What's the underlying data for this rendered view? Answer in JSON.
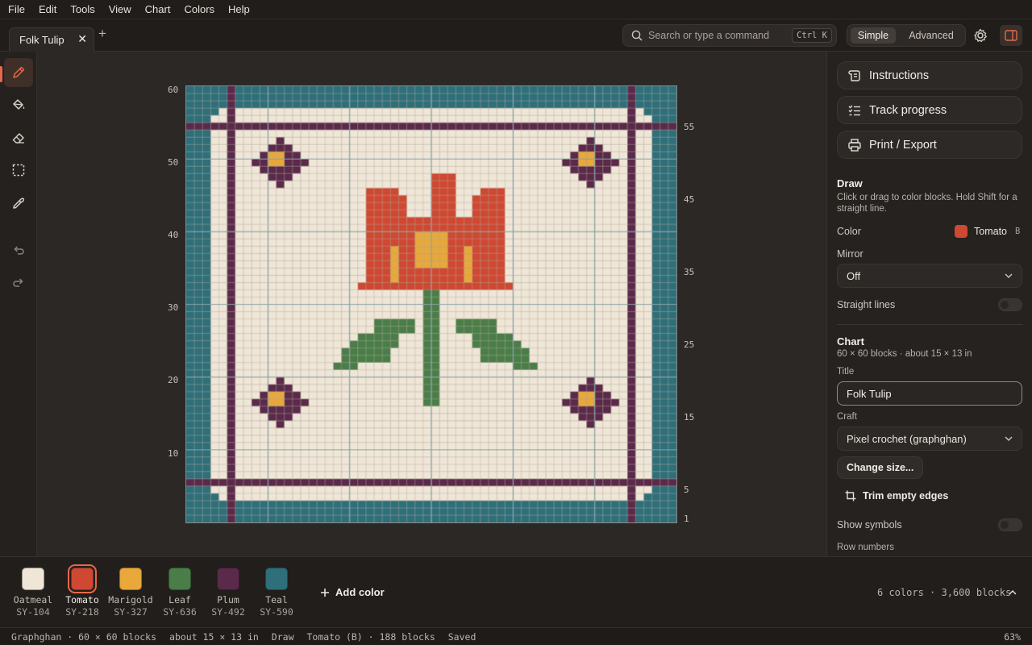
{
  "menu": [
    "File",
    "Edit",
    "Tools",
    "View",
    "Chart",
    "Colors",
    "Help"
  ],
  "tab": {
    "title": "Folk Tulip",
    "close": "✕",
    "add": "+"
  },
  "search": {
    "placeholder": "Search or type a command",
    "shortcut": "Ctrl K"
  },
  "mode": {
    "simple": "Simple",
    "advanced": "Advanced"
  },
  "tools": [
    "pencil-icon",
    "paint-bucket-icon",
    "eraser-icon",
    "select-icon",
    "eyedropper-icon",
    "undo-icon",
    "redo-icon"
  ],
  "grid": {
    "cols": 60,
    "rows": 60,
    "left_numbers": [
      "60",
      "50",
      "40",
      "30",
      "20",
      "10"
    ],
    "right_numbers": [
      "55",
      "45",
      "35",
      "25",
      "15",
      "5",
      "1"
    ]
  },
  "side": {
    "instructions": "Instructions",
    "track": "Track progress",
    "print": "Print / Export",
    "draw_title": "Draw",
    "draw_hint": "Click or drag to color blocks. Hold Shift for a straight line.",
    "color_label": "Color",
    "color_value": "Tomato",
    "color_key": "B",
    "mirror_label": "Mirror",
    "mirror_value": "Off",
    "straight_label": "Straight lines",
    "chart_title": "Chart",
    "chart_info": "60 × 60 blocks · about 15 × 13 in",
    "title_label": "Title",
    "title_value": "Folk Tulip",
    "craft_label": "Craft",
    "craft_value": "Pixel crochet (graphghan)",
    "change_size": "Change size...",
    "trim": "Trim empty edges",
    "show_symbols": "Show symbols",
    "row_numbers": "Row numbers"
  },
  "palette": {
    "colors": [
      {
        "name": "Oatmeal",
        "code": "SY-104",
        "hex": "#efe6d7"
      },
      {
        "name": "Tomato",
        "code": "SY-218",
        "hex": "#cf4832"
      },
      {
        "name": "Marigold",
        "code": "SY-327",
        "hex": "#e8a83a"
      },
      {
        "name": "Leaf",
        "code": "SY-636",
        "hex": "#4a7d48"
      },
      {
        "name": "Plum",
        "code": "SY-492",
        "hex": "#5b2a4a"
      },
      {
        "name": "Teal",
        "code": "SY-590",
        "hex": "#2e6f7a"
      }
    ],
    "add": "Add color",
    "stats": "6 colors · 3,600 blocks"
  },
  "status": {
    "craft": "Graphghan · 60 × 60 blocks",
    "size": "about 15 × 13 in",
    "tool": "Draw",
    "color": "Tomato (B) · 188 blocks",
    "saved": "Saved",
    "zoom": "63%"
  },
  "colors": {
    "accent": "#e7684c",
    "gridline": "#b8aea0",
    "majorline": "#8aa3a6"
  }
}
